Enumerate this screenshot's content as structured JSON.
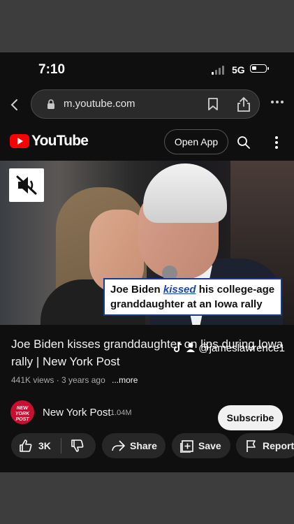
{
  "status_bar": {
    "time": "7:10",
    "network": "5G"
  },
  "browser": {
    "url": "m.youtube.com"
  },
  "youtube": {
    "brand": "YouTube",
    "open_app_label": "Open App"
  },
  "video": {
    "caption_line1_pre": "Joe Biden ",
    "caption_line1_highlight": "kissed",
    "caption_line1_post": " his college-age",
    "caption_line2": "granddaughter at an Iowa rally"
  },
  "info": {
    "title": "Joe Biden kisses granddaughter on lips during Iowa rally | New York Post",
    "views": "441K views",
    "age": "· 3 years ago",
    "more_label": "...more"
  },
  "channel": {
    "avatar_line1": "NEW",
    "avatar_line2": "YORK",
    "avatar_line3": "POST",
    "name": "New York Post",
    "subscribers": "1.04M",
    "subscribe_label": "Subscribe",
    "watermark_handle": "@jameslawrence1"
  },
  "actions": {
    "like_count": "3K",
    "share_label": "Share",
    "save_label": "Save",
    "report_label": "Report"
  },
  "colors": {
    "youtube_red": "#ff0000",
    "background": "#0f0f0f",
    "pill": "#272727",
    "nyp_red": "#c8102e"
  }
}
